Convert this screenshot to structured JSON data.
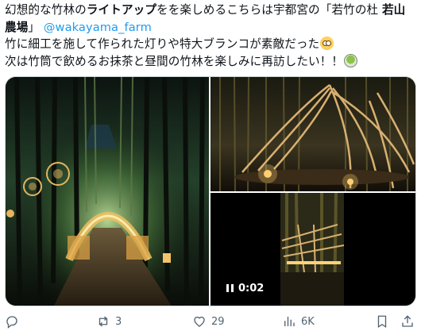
{
  "tweet": {
    "line1_prefix": "幻想的な竹林の",
    "line1_bold": "ライトアップ",
    "line1_mid": "をを楽しめるこちらは宇都宮の「若竹の杜 ",
    "line1_bold2": "若山",
    "line2_bold": "農場",
    "line2_close": "」",
    "mention": "@wakayama_farm",
    "line3": "竹に細工を施して作られた灯りや特大ブランコが素敵だった",
    "line4": "次は竹筒で飲めるお抹茶と昼間の竹林を楽しみに再訪したい！！",
    "emoji1": "flushed-face",
    "emoji2": "matcha-tea"
  },
  "media": {
    "video_duration": "0:02"
  },
  "actions": {
    "reply_count": "",
    "retweet_count": "3",
    "like_count": "29",
    "views_count": "6K"
  },
  "colors": {
    "text": "#0f1419",
    "mention": "#1d9bf0",
    "muted": "#536471",
    "border": "#cfd9de"
  }
}
